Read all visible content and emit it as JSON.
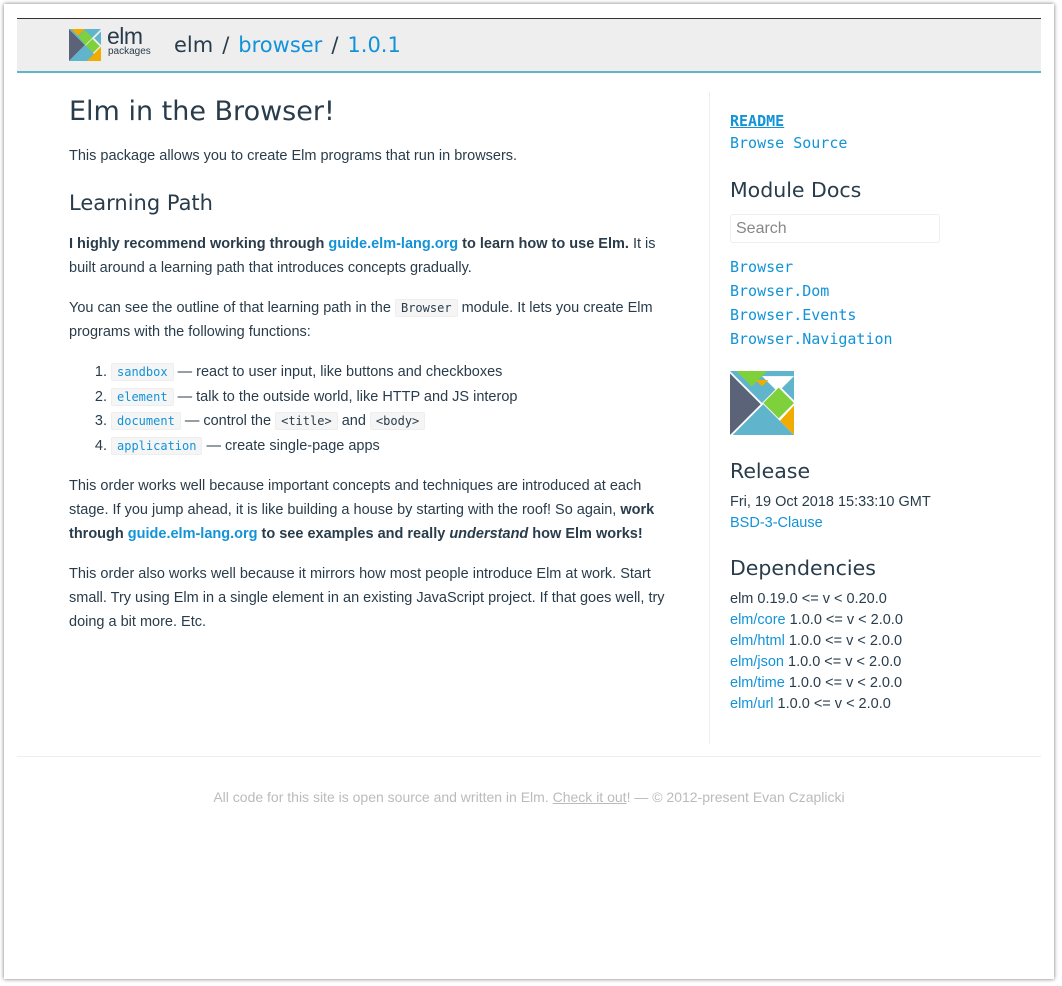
{
  "header": {
    "logo_word": "elm",
    "logo_sub": "packages",
    "crumb_author": "elm",
    "crumb_sep_1": "/",
    "crumb_package": "browser",
    "crumb_sep_2": "/",
    "crumb_version": "1.0.1"
  },
  "main": {
    "title": "Elm in the Browser!",
    "intro": "This package allows you to create Elm programs that run in browsers.",
    "learning_heading": "Learning Path",
    "p1": {
      "bold_before": "I highly recommend working through ",
      "link": "guide.elm-lang.org",
      "bold_after": " to learn how to use Elm.",
      "rest": " It is built around a learning path that introduces concepts gradually."
    },
    "p2": {
      "before": "You can see the outline of that learning path in the ",
      "code": "Browser",
      "after": " module. It lets you create Elm programs with the following functions:"
    },
    "functions": [
      {
        "code": "sandbox",
        "desc": " — react to user input, like buttons and checkboxes"
      },
      {
        "code": "element",
        "desc": " — talk to the outside world, like HTTP and JS interop"
      },
      {
        "code": "document",
        "desc_before": " — control the ",
        "code2": "<title>",
        "mid": " and ",
        "code3": "<body>"
      },
      {
        "code": "application",
        "desc": " — create single-page apps"
      }
    ],
    "p3": {
      "text": "This order works well because important concepts and techniques are introduced at each stage. If you jump ahead, it is like building a house by starting with the roof! So again, ",
      "bold_before": "work through ",
      "link": "guide.elm-lang.org",
      "bold_mid": " to see examples and really ",
      "bold_italic": "understand",
      "bold_after": " how Elm works!"
    },
    "p4": "This order also works well because it mirrors how most people introduce Elm at work. Start small. Try using Elm in a single element in an existing JavaScript project. If that goes well, try doing a bit more. Etc."
  },
  "sidebar": {
    "readme": "README",
    "browse_source": "Browse Source",
    "module_docs_heading": "Module Docs",
    "search_placeholder": "Search",
    "modules": [
      "Browser",
      "Browser.Dom",
      "Browser.Events",
      "Browser.Navigation"
    ],
    "release_heading": "Release",
    "release_date": "Fri, 19 Oct 2018 15:33:10 GMT",
    "license": "BSD-3-Clause",
    "dependencies_heading": "Dependencies",
    "elm_dep": "elm 0.19.0 <= v < 0.20.0",
    "deps": [
      {
        "name": "elm/core",
        "range": " 1.0.0 <= v < 2.0.0"
      },
      {
        "name": "elm/html",
        "range": " 1.0.0 <= v < 2.0.0"
      },
      {
        "name": "elm/json",
        "range": " 1.0.0 <= v < 2.0.0"
      },
      {
        "name": "elm/time",
        "range": " 1.0.0 <= v < 2.0.0"
      },
      {
        "name": "elm/url",
        "range": " 1.0.0 <= v < 2.0.0"
      }
    ]
  },
  "footer": {
    "before": "All code for this site is open source and written in Elm. ",
    "link": "Check it out",
    "after": "! — © 2012-present Evan Czaplicki"
  },
  "colors": {
    "accent": "#1293d8",
    "header_border": "#60b5cc",
    "text": "#293c4b",
    "tangram_orange": "#f0ad00",
    "tangram_green": "#7fd13b",
    "tangram_blue": "#60b5cc",
    "tangram_slate": "#5a6378"
  },
  "icons": {
    "header_logo": "elm-tangram-icon",
    "sidebar_logo": "elm-tangram-icon"
  }
}
